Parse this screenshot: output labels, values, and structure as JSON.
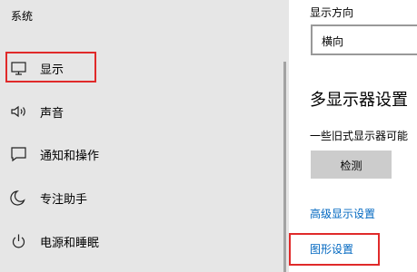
{
  "sidebar": {
    "title": "系统",
    "items": [
      {
        "label": "显示",
        "icon": "monitor-icon"
      },
      {
        "label": "声音",
        "icon": "speaker-icon"
      },
      {
        "label": "通知和操作",
        "icon": "notification-icon"
      },
      {
        "label": "专注助手",
        "icon": "moon-icon"
      },
      {
        "label": "电源和睡眠",
        "icon": "power-icon"
      }
    ],
    "highlight_color": "#e02a2a"
  },
  "content": {
    "orientation_label": "显示方向",
    "orientation_value": "横向",
    "multi_display_heading": "多显示器设置",
    "legacy_text": "一些旧式显示器可能",
    "detect_label": "检测",
    "advanced_link": "高级显示设置",
    "graphics_link": "图形设置",
    "link_color": "#0067c0"
  }
}
